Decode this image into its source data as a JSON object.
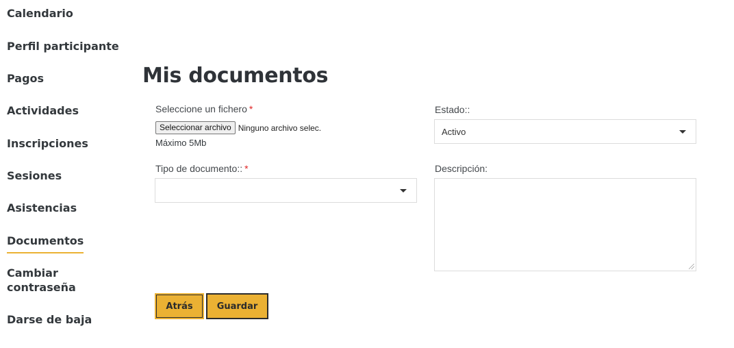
{
  "sidebar": {
    "items": [
      {
        "label": "Calendario"
      },
      {
        "label": "Perfil participante"
      },
      {
        "label": "Pagos"
      },
      {
        "label": "Actividades"
      },
      {
        "label": "Inscripciones"
      },
      {
        "label": "Sesiones"
      },
      {
        "label": "Asistencias"
      },
      {
        "label": "Documentos",
        "active": true
      },
      {
        "label": "Cambiar contraseña"
      },
      {
        "label": "Darse de baja"
      }
    ],
    "accent_color": "#ebb133"
  },
  "main": {
    "title": "Mis documentos",
    "file": {
      "label": "Seleccione un fichero",
      "required_mark": "*",
      "button_label": "Seleccionar archivo",
      "status": "Ninguno archivo selec.",
      "hint": "Máximo 5Mb"
    },
    "estado": {
      "label": "Estado::",
      "selected": "Activo"
    },
    "tipo": {
      "label": "Tipo de documento::",
      "required_mark": "*",
      "selected": ""
    },
    "descripcion": {
      "label": "Descripción:",
      "value": ""
    },
    "buttons": {
      "back_label": "Atrás",
      "save_label": "Guardar",
      "color": "#ebb133"
    }
  }
}
